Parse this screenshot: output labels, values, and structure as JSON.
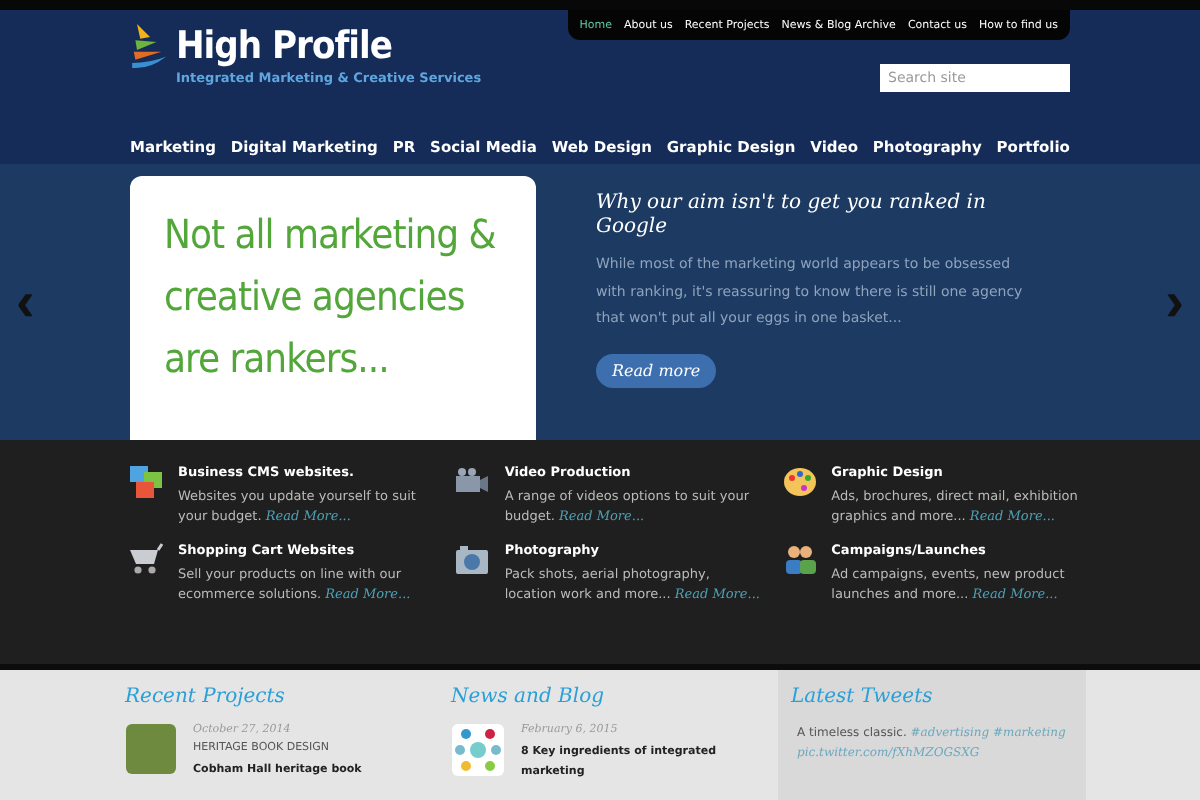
{
  "top_menu": [
    {
      "label": "Home",
      "selected": true
    },
    {
      "label": "About us",
      "selected": false
    },
    {
      "label": "Recent Projects",
      "selected": false
    },
    {
      "label": "News & Blog Archive",
      "selected": false
    },
    {
      "label": "Contact us",
      "selected": false
    },
    {
      "label": "How to find us",
      "selected": false
    }
  ],
  "logo": {
    "name": "High Profile",
    "tagline": "Integrated Marketing & Creative Services"
  },
  "search": {
    "placeholder": "Search site"
  },
  "main_nav": [
    "Marketing",
    "Digital Marketing",
    "PR",
    "Social Media",
    "Web Design",
    "Graphic Design",
    "Video",
    "Photography",
    "Portfolio"
  ],
  "slider": {
    "prev": "‹",
    "next": "›",
    "card_lines": [
      "Not all marketing &",
      "creative agencies",
      "are rankers..."
    ],
    "title": "Why our aim isn't to get you ranked in Google",
    "text": "While most of the marketing world appears to be obsessed with ranking, it's reassuring to know there is still one agency that won't put all your eggs in one basket...",
    "button": "Read more"
  },
  "services": [
    {
      "kind": "pictures",
      "title": "Business CMS websites.",
      "text": "Websites you update yourself to suit your budget.",
      "link": "Read More..."
    },
    {
      "kind": "video",
      "title": "Video Production",
      "text": "A range of videos options to suit your budget.",
      "link": "Read More..."
    },
    {
      "kind": "palette",
      "title": "Graphic Design",
      "text": "Ads, brochures, direct mail, exhibition graphics and more...",
      "link": "Read More..."
    },
    {
      "kind": "cart",
      "title": "Shopping Cart Websites",
      "text": "Sell your products on line with our ecommerce solutions.",
      "link": "Read More..."
    },
    {
      "kind": "camera",
      "title": "Photography",
      "text": "Pack shots, aerial photography, location work and more...",
      "link": "Read More..."
    },
    {
      "kind": "people",
      "title": "Campaigns/Launches",
      "text": "Ad campaigns, events, new product launches and more...",
      "link": "Read More..."
    }
  ],
  "recent_projects": {
    "heading": "Recent Projects",
    "date": "October 27, 2014",
    "category": "HERITAGE BOOK DESIGN",
    "title": "Cobham Hall heritage book"
  },
  "news": {
    "heading": "News and Blog",
    "date": "February 6, 2015",
    "title": "8 Key ingredients of integrated marketing"
  },
  "tweets": {
    "heading": "Latest Tweets",
    "text": "A timeless classic.",
    "tags": [
      "#advertising",
      "#marketing"
    ],
    "link": "pic.twitter.com/fXhMZOGSXG"
  }
}
